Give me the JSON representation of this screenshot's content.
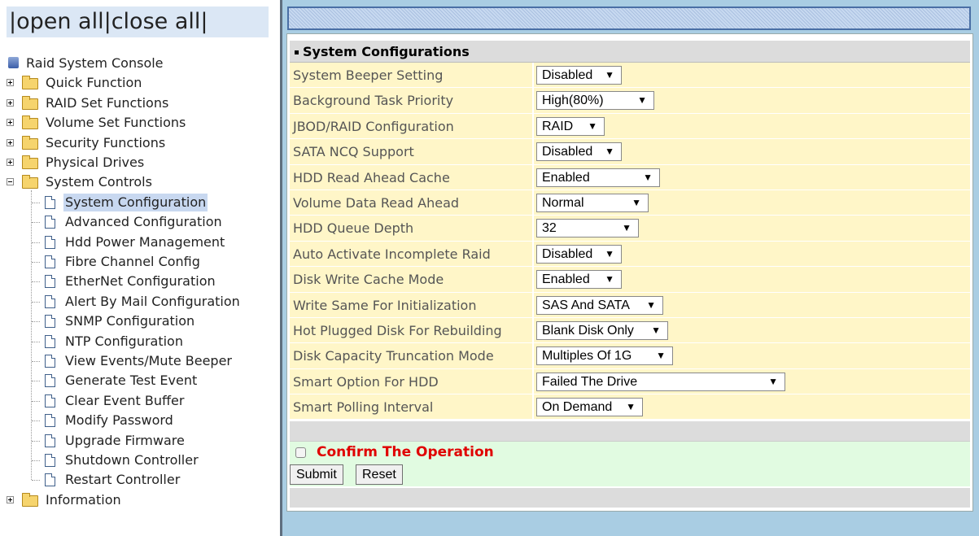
{
  "tree_header": {
    "open_all": "|open all",
    "close_all": "|close all|"
  },
  "tree": {
    "root": "Raid System Console",
    "folders": [
      "Quick Function",
      "RAID Set Functions",
      "Volume Set Functions",
      "Security Functions",
      "Physical Drives",
      "System Controls"
    ],
    "system_controls_items": [
      "System Configuration",
      "Advanced Configuration",
      "Hdd Power Management",
      "Fibre Channel Config",
      "EtherNet Configuration",
      "Alert By Mail Configuration",
      "SNMP Configuration",
      "NTP Configuration",
      "View Events/Mute Beeper",
      "Generate Test Event",
      "Clear Event Buffer",
      "Modify Password",
      "Upgrade Firmware",
      "Shutdown Controller",
      "Restart Controller"
    ],
    "last_folder": "Information"
  },
  "form": {
    "title": "System Configurations",
    "rows": [
      {
        "label": "System Beeper Setting",
        "value": "Disabled"
      },
      {
        "label": "Background Task Priority",
        "value": "High(80%)"
      },
      {
        "label": "JBOD/RAID Configuration",
        "value": "RAID"
      },
      {
        "label": "SATA NCQ Support",
        "value": "Disabled"
      },
      {
        "label": "HDD Read Ahead Cache",
        "value": "Enabled"
      },
      {
        "label": "Volume Data Read Ahead",
        "value": "Normal"
      },
      {
        "label": "HDD Queue Depth",
        "value": "32"
      },
      {
        "label": "Auto Activate Incomplete Raid",
        "value": "Disabled"
      },
      {
        "label": "Disk Write Cache Mode",
        "value": "Enabled"
      },
      {
        "label": "Write Same For Initialization",
        "value": "SAS And SATA"
      },
      {
        "label": "Hot Plugged Disk For Rebuilding",
        "value": "Blank Disk Only"
      },
      {
        "label": "Disk Capacity Truncation Mode",
        "value": "Multiples Of 1G"
      },
      {
        "label": "Smart Option For HDD",
        "value": "Failed The Drive"
      },
      {
        "label": "Smart Polling Interval",
        "value": "On Demand"
      }
    ],
    "arrow": "▼",
    "confirm": "Confirm The Operation",
    "submit": "Submit",
    "reset": "Reset"
  },
  "colors": {
    "row_bg": "#fff6c8",
    "confirm_bg": "#e1fbe1",
    "confirm_text": "#e00000",
    "right_bg": "#a9cde3"
  }
}
